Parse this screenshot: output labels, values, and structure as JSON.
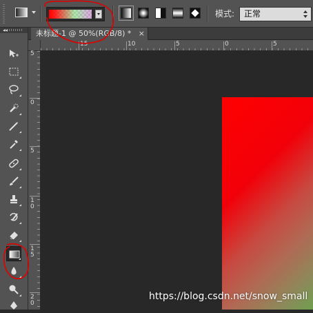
{
  "options_bar": {
    "tool_preset_icon": "gradient-tool-preset-icon",
    "gradient_picker": {
      "colors": [
        "#ff0000",
        "#7ddc7d",
        "#c07acb"
      ],
      "transparency": "checkerboard"
    },
    "gradient_types": [
      {
        "name": "linear-gradient",
        "icon": "linear-gradient-icon",
        "active": true
      },
      {
        "name": "radial-gradient",
        "icon": "radial-gradient-icon",
        "active": false
      },
      {
        "name": "angle-gradient",
        "icon": "angle-gradient-icon",
        "active": false
      },
      {
        "name": "reflected-gradient",
        "icon": "reflected-gradient-icon",
        "active": false
      },
      {
        "name": "diamond-gradient",
        "icon": "diamond-gradient-icon",
        "active": false
      }
    ],
    "mode_label": "模式:",
    "mode_value": "正常"
  },
  "document_tab": {
    "title": "未标题-1 @ 50%(RGB/8) *",
    "close": "×"
  },
  "rulers": {
    "horizontal_labels": [
      "15",
      "10",
      "5",
      "0",
      "5"
    ],
    "vertical_labels": [
      "5",
      "0",
      "5",
      "1\n0",
      "1\n5",
      "2\n0"
    ]
  },
  "toolbar": {
    "tools": [
      {
        "name": "move-tool",
        "icon": "move-icon"
      },
      {
        "name": "marquee-tool",
        "icon": "rect-marquee-icon"
      },
      {
        "name": "lasso-tool",
        "icon": "lasso-icon"
      },
      {
        "name": "quick-selection-tool",
        "icon": "quick-selection-icon"
      },
      {
        "name": "crop-tool",
        "icon": "crop-icon"
      },
      {
        "name": "eyedropper-tool",
        "icon": "eyedropper-icon"
      },
      {
        "name": "healing-brush-tool",
        "icon": "bandage-icon"
      },
      {
        "name": "brush-tool",
        "icon": "brush-icon"
      },
      {
        "name": "clone-stamp-tool",
        "icon": "stamp-icon"
      },
      {
        "name": "history-brush-tool",
        "icon": "history-brush-icon"
      },
      {
        "name": "eraser-tool",
        "icon": "eraser-icon"
      },
      {
        "name": "gradient-tool",
        "icon": "gradient-icon",
        "selected": true
      },
      {
        "name": "blur-tool",
        "icon": "drop-icon"
      },
      {
        "name": "dodge-tool",
        "icon": "dodge-icon"
      },
      {
        "name": "pen-tool",
        "icon": "pen-icon"
      }
    ]
  },
  "canvas": {
    "gradient_colors": [
      "#ff0000",
      "#c8483f",
      "#62a84a"
    ]
  },
  "watermark": "https://blog.csdn.net/snow_small",
  "annotations": {
    "color": "#e00000"
  }
}
